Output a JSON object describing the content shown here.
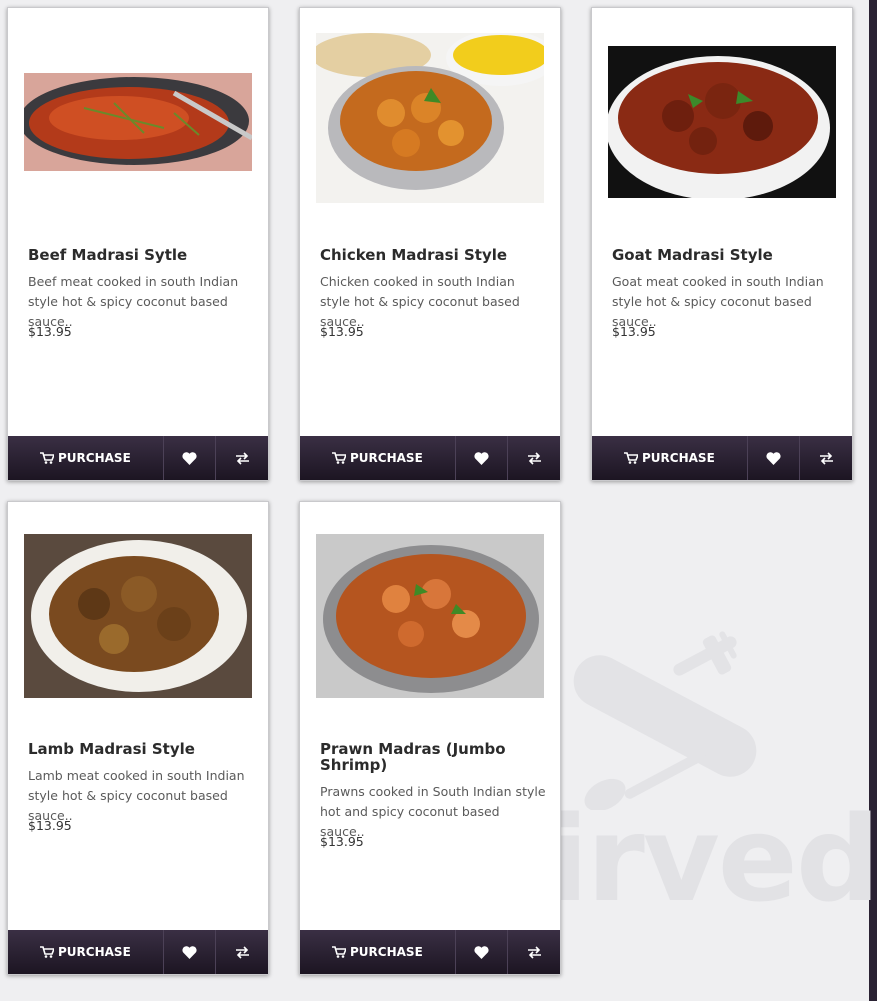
{
  "products": [
    {
      "title": "Beef Madrasi Sytle",
      "desc": "Beef meat cooked in south Indian style hot & spicy coconut based sauce..",
      "price": "$13.95",
      "purchase_label": "PURCHASE"
    },
    {
      "title": "Chicken Madrasi Style",
      "desc": "Chicken cooked in south Indian style hot & spicy coconut based sauce..",
      "price": "$13.95",
      "purchase_label": "PURCHASE"
    },
    {
      "title": "Goat Madrasi Style",
      "desc": "Goat meat cooked in south Indian style hot & spicy coconut based sauce..",
      "price": "$13.95",
      "purchase_label": "PURCHASE"
    },
    {
      "title": "Lamb Madrasi Style",
      "desc": "Lamb meat cooked in south Indian style hot & spicy coconut based sauce..",
      "price": "$13.95",
      "purchase_label": "PURCHASE"
    },
    {
      "title": "Prawn Madras (Jumbo Shrimp)",
      "desc": "Prawns cooked in South Indian style hot and spicy coconut based sauce..",
      "price": "$13.95",
      "purchase_label": "PURCHASE"
    }
  ],
  "watermark": {
    "text": "sirved"
  },
  "icons": {
    "cart": "cart-icon",
    "heart": "heart-icon",
    "compare": "compare-arrows-icon"
  },
  "colors": {
    "action_bar": "#2a2130",
    "card_bg": "#ffffff",
    "page_bg": "#efeff1"
  }
}
